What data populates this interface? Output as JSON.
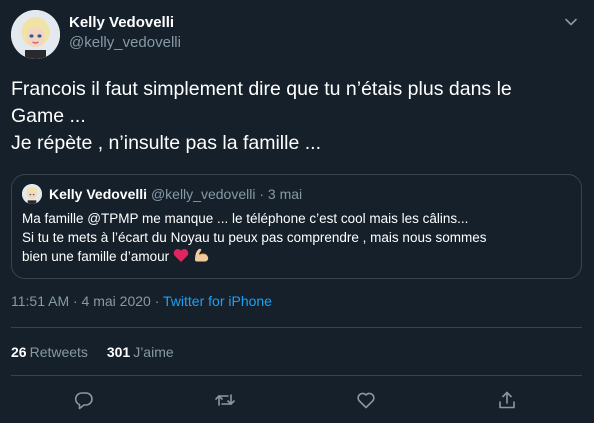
{
  "tweet": {
    "author": {
      "name": "Kelly Vedovelli",
      "handle": "@kelly_vedovelli"
    },
    "text_lines": [
      "Francois il faut simplement dire que tu n’étais plus dans le",
      "Game ...",
      "Je répète , n’insulte pas la famille ..."
    ],
    "quote": {
      "author": {
        "name": "Kelly Vedovelli",
        "handle": "@kelly_vedovelli"
      },
      "separator": "·",
      "date": "3 mai",
      "text_lines": [
        "Ma famille @TPMP me manque ... le téléphone c’est cool mais les câlins...",
        "Si tu te mets à l’écart du Noyau tu peux pas comprendre , mais nous sommes",
        "bien une famille d’amour"
      ],
      "emojis": [
        "red-heart-emoji",
        "flexed-biceps-emoji"
      ]
    },
    "meta": {
      "timestamp": "11:51 AM · 4 mai 2020",
      "separator": "·",
      "source": "Twitter for iPhone"
    },
    "stats": {
      "retweets_count": "26",
      "retweets_label": "Retweets",
      "likes_count": "301",
      "likes_label": "J’aime"
    },
    "actions": [
      "reply-icon",
      "retweet-icon",
      "like-icon",
      "share-icon"
    ]
  },
  "colors": {
    "background": "#15202b",
    "text": "#ffffff",
    "secondary_text": "#8899a6",
    "link": "#1da1f2",
    "border": "#38444d"
  }
}
